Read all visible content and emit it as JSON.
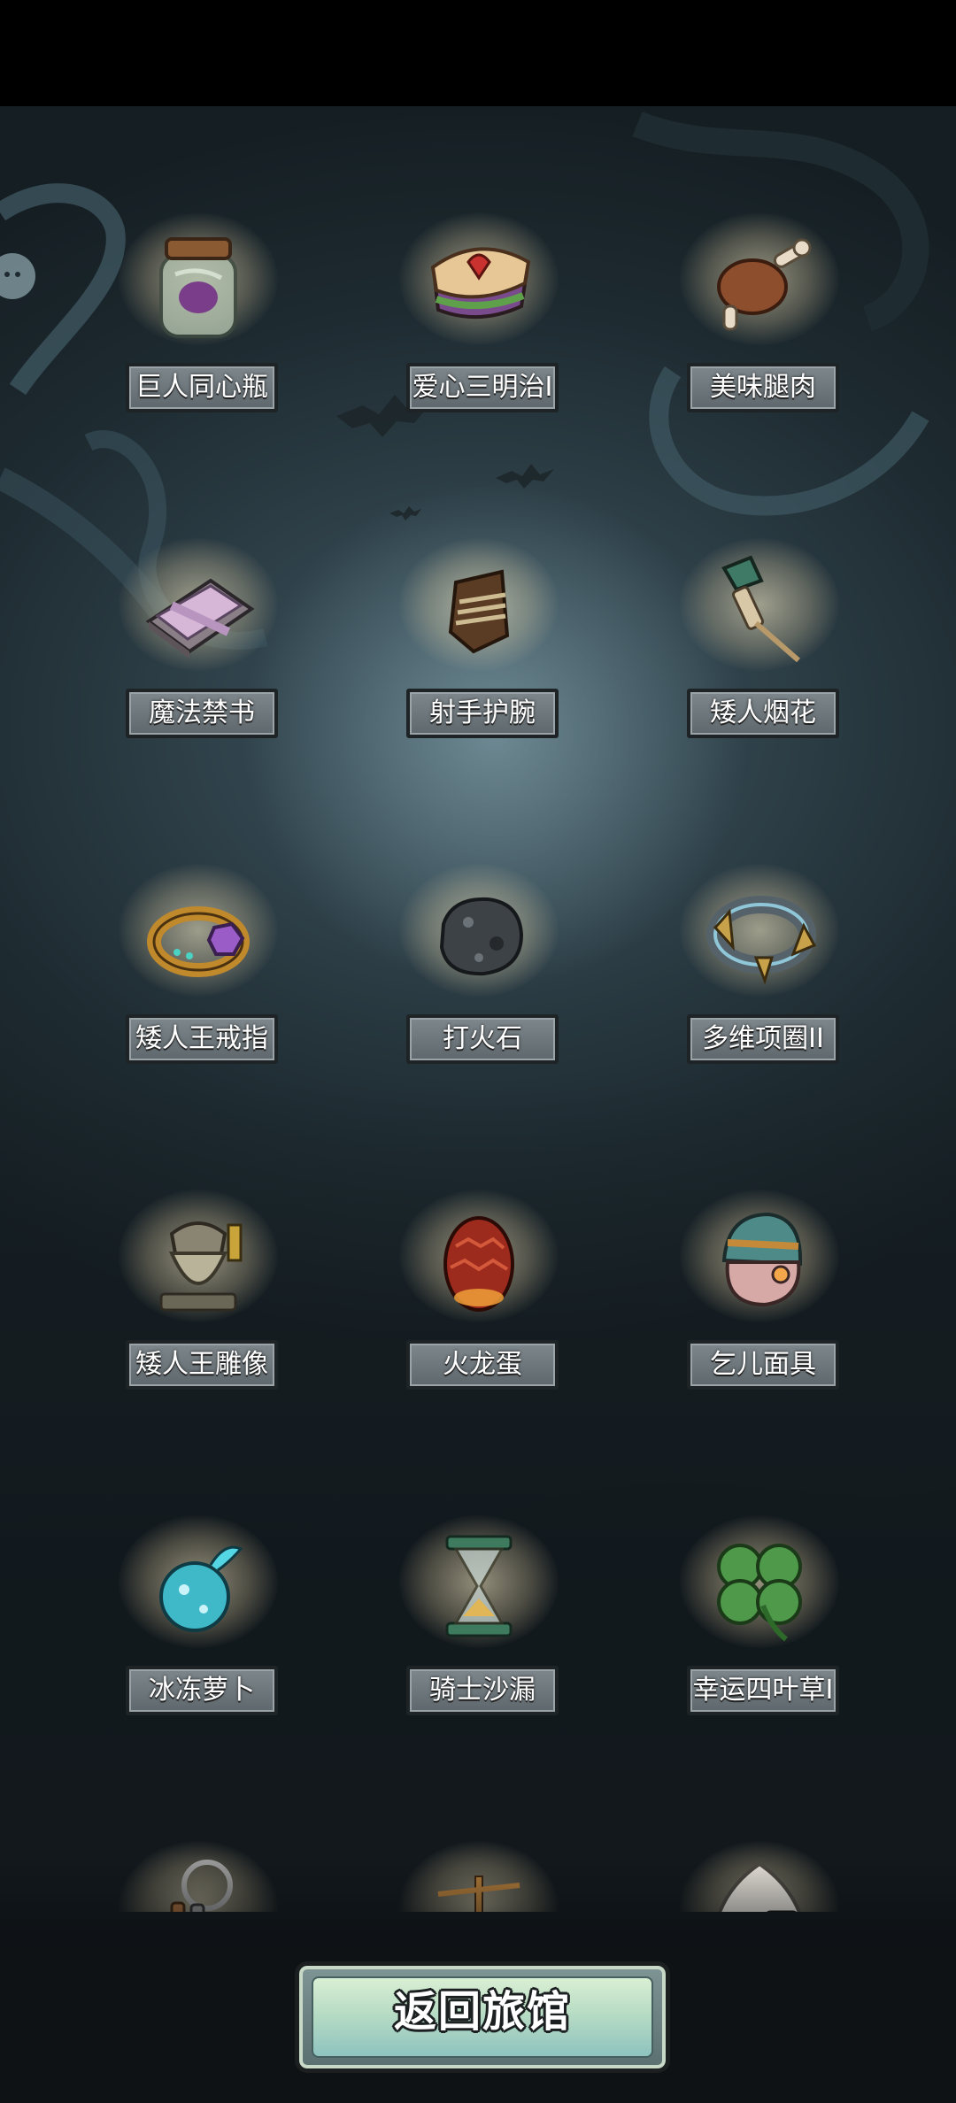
{
  "items": [
    {
      "label": "巨人同心瓶",
      "icon": "jar-icon"
    },
    {
      "label": "爱心三明治I",
      "icon": "sandwich-icon"
    },
    {
      "label": "美味腿肉",
      "icon": "meat-leg-icon"
    },
    {
      "label": "魔法禁书",
      "icon": "spellbook-icon"
    },
    {
      "label": "射手护腕",
      "icon": "bracer-icon"
    },
    {
      "label": "矮人烟花",
      "icon": "firework-icon"
    },
    {
      "label": "矮人王戒指",
      "icon": "ring-icon"
    },
    {
      "label": "打火石",
      "icon": "flint-stone-icon"
    },
    {
      "label": "多维项圈II",
      "icon": "collar-icon"
    },
    {
      "label": "矮人王雕像",
      "icon": "dwarf-statue-icon"
    },
    {
      "label": "火龙蛋",
      "icon": "dragon-egg-icon"
    },
    {
      "label": "乞儿面具",
      "icon": "beggar-mask-icon"
    },
    {
      "label": "冰冻萝卜",
      "icon": "frozen-radish-icon"
    },
    {
      "label": "骑士沙漏",
      "icon": "hourglass-icon"
    },
    {
      "label": "幸运四叶草I",
      "icon": "clover-icon"
    },
    {
      "label": "",
      "icon": "keyring-icon"
    },
    {
      "label": "",
      "icon": "scales-icon"
    },
    {
      "label": "",
      "icon": "rice-ball-icon"
    }
  ],
  "footer": {
    "return_button": "返回旅馆"
  }
}
